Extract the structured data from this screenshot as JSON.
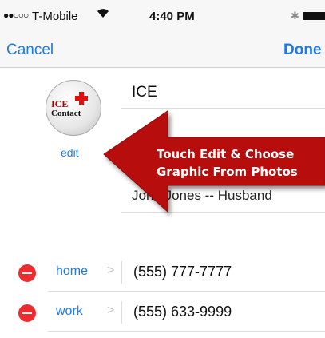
{
  "status_bar": {
    "signal": "●●○○○",
    "carrier": "T-Mobile",
    "wifi": "◔",
    "time": "4:40 PM",
    "bluetooth": "✱"
  },
  "nav": {
    "cancel": "Cancel",
    "done": "Done"
  },
  "contact": {
    "avatar_text_1": "ICE",
    "avatar_text_2": "Contact",
    "edit": "edit",
    "first_name": "ICE",
    "last_name": "John Jones -- Husband"
  },
  "phones": [
    {
      "label": "home",
      "chevron": ">",
      "value": "(555) 777-7777"
    },
    {
      "label": "work",
      "chevron": ">",
      "value": "(555) 633-9999"
    }
  ],
  "annotation": {
    "line1": "Touch Edit & Choose",
    "line2": "Graphic From Photos"
  },
  "colors": {
    "accent": "#1f7ae6",
    "delete": "#ee2b2f",
    "arrow": "#b80d10"
  }
}
